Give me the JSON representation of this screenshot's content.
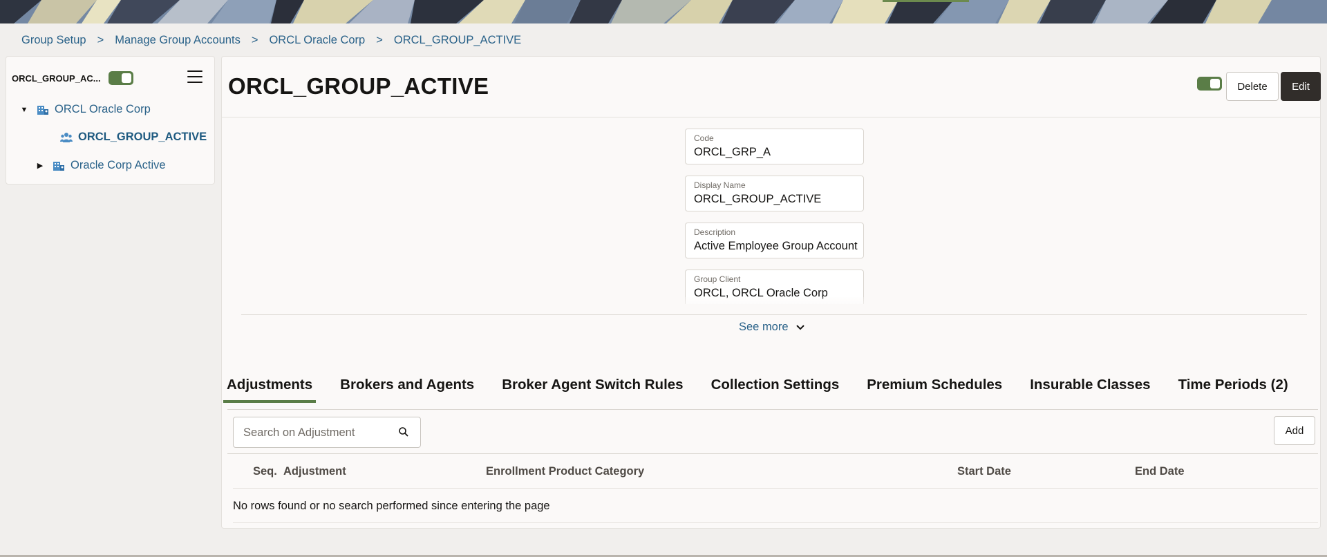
{
  "breadcrumb": [
    "Group Setup",
    "Manage Group Accounts",
    "ORCL Oracle Corp",
    "ORCL_GROUP_ACTIVE"
  ],
  "breadcrumb_separator": ">",
  "tree": {
    "title": "ORCL_GROUP_AC...",
    "toggle_on": true,
    "items": [
      {
        "label": "ORCL Oracle Corp",
        "expanded": true,
        "icon": "group-client-icon"
      },
      {
        "label": "ORCL_GROUP_ACTIVE",
        "selected": true,
        "icon": "group-people-icon"
      },
      {
        "label": "Oracle Corp Active",
        "expanded": false,
        "icon": "group-client-icon"
      }
    ]
  },
  "header": {
    "title": "ORCL_GROUP_ACTIVE",
    "toggle_on": true,
    "delete_label": "Delete",
    "edit_label": "Edit"
  },
  "fields": [
    {
      "label": "Code",
      "value": "ORCL_GRP_A"
    },
    {
      "label": "Display Name",
      "value": "ORCL_GROUP_ACTIVE"
    },
    {
      "label": "Description",
      "value": "Active Employee Group Account"
    },
    {
      "label": "Group Client",
      "value": "ORCL, ORCL Oracle Corp"
    }
  ],
  "see_more_label": "See more",
  "tabs": [
    {
      "label": "Adjustments",
      "active": true
    },
    {
      "label": "Brokers and Agents"
    },
    {
      "label": "Broker Agent Switch Rules"
    },
    {
      "label": "Collection Settings"
    },
    {
      "label": "Premium Schedules"
    },
    {
      "label": "Insurable Classes"
    },
    {
      "label": "Time Periods (2)"
    }
  ],
  "search": {
    "placeholder": "Search on Adjustment",
    "value": ""
  },
  "add_label": "Add",
  "table": {
    "columns": [
      "Seq.",
      "Adjustment",
      "Enrollment Product Category",
      "Start Date",
      "End Date"
    ],
    "empty_message": "No rows found or no search performed since entering the page"
  },
  "colors": {
    "accent_green": "#5a7d47",
    "link_blue": "#2a6289",
    "dark_button": "#312d2a"
  }
}
